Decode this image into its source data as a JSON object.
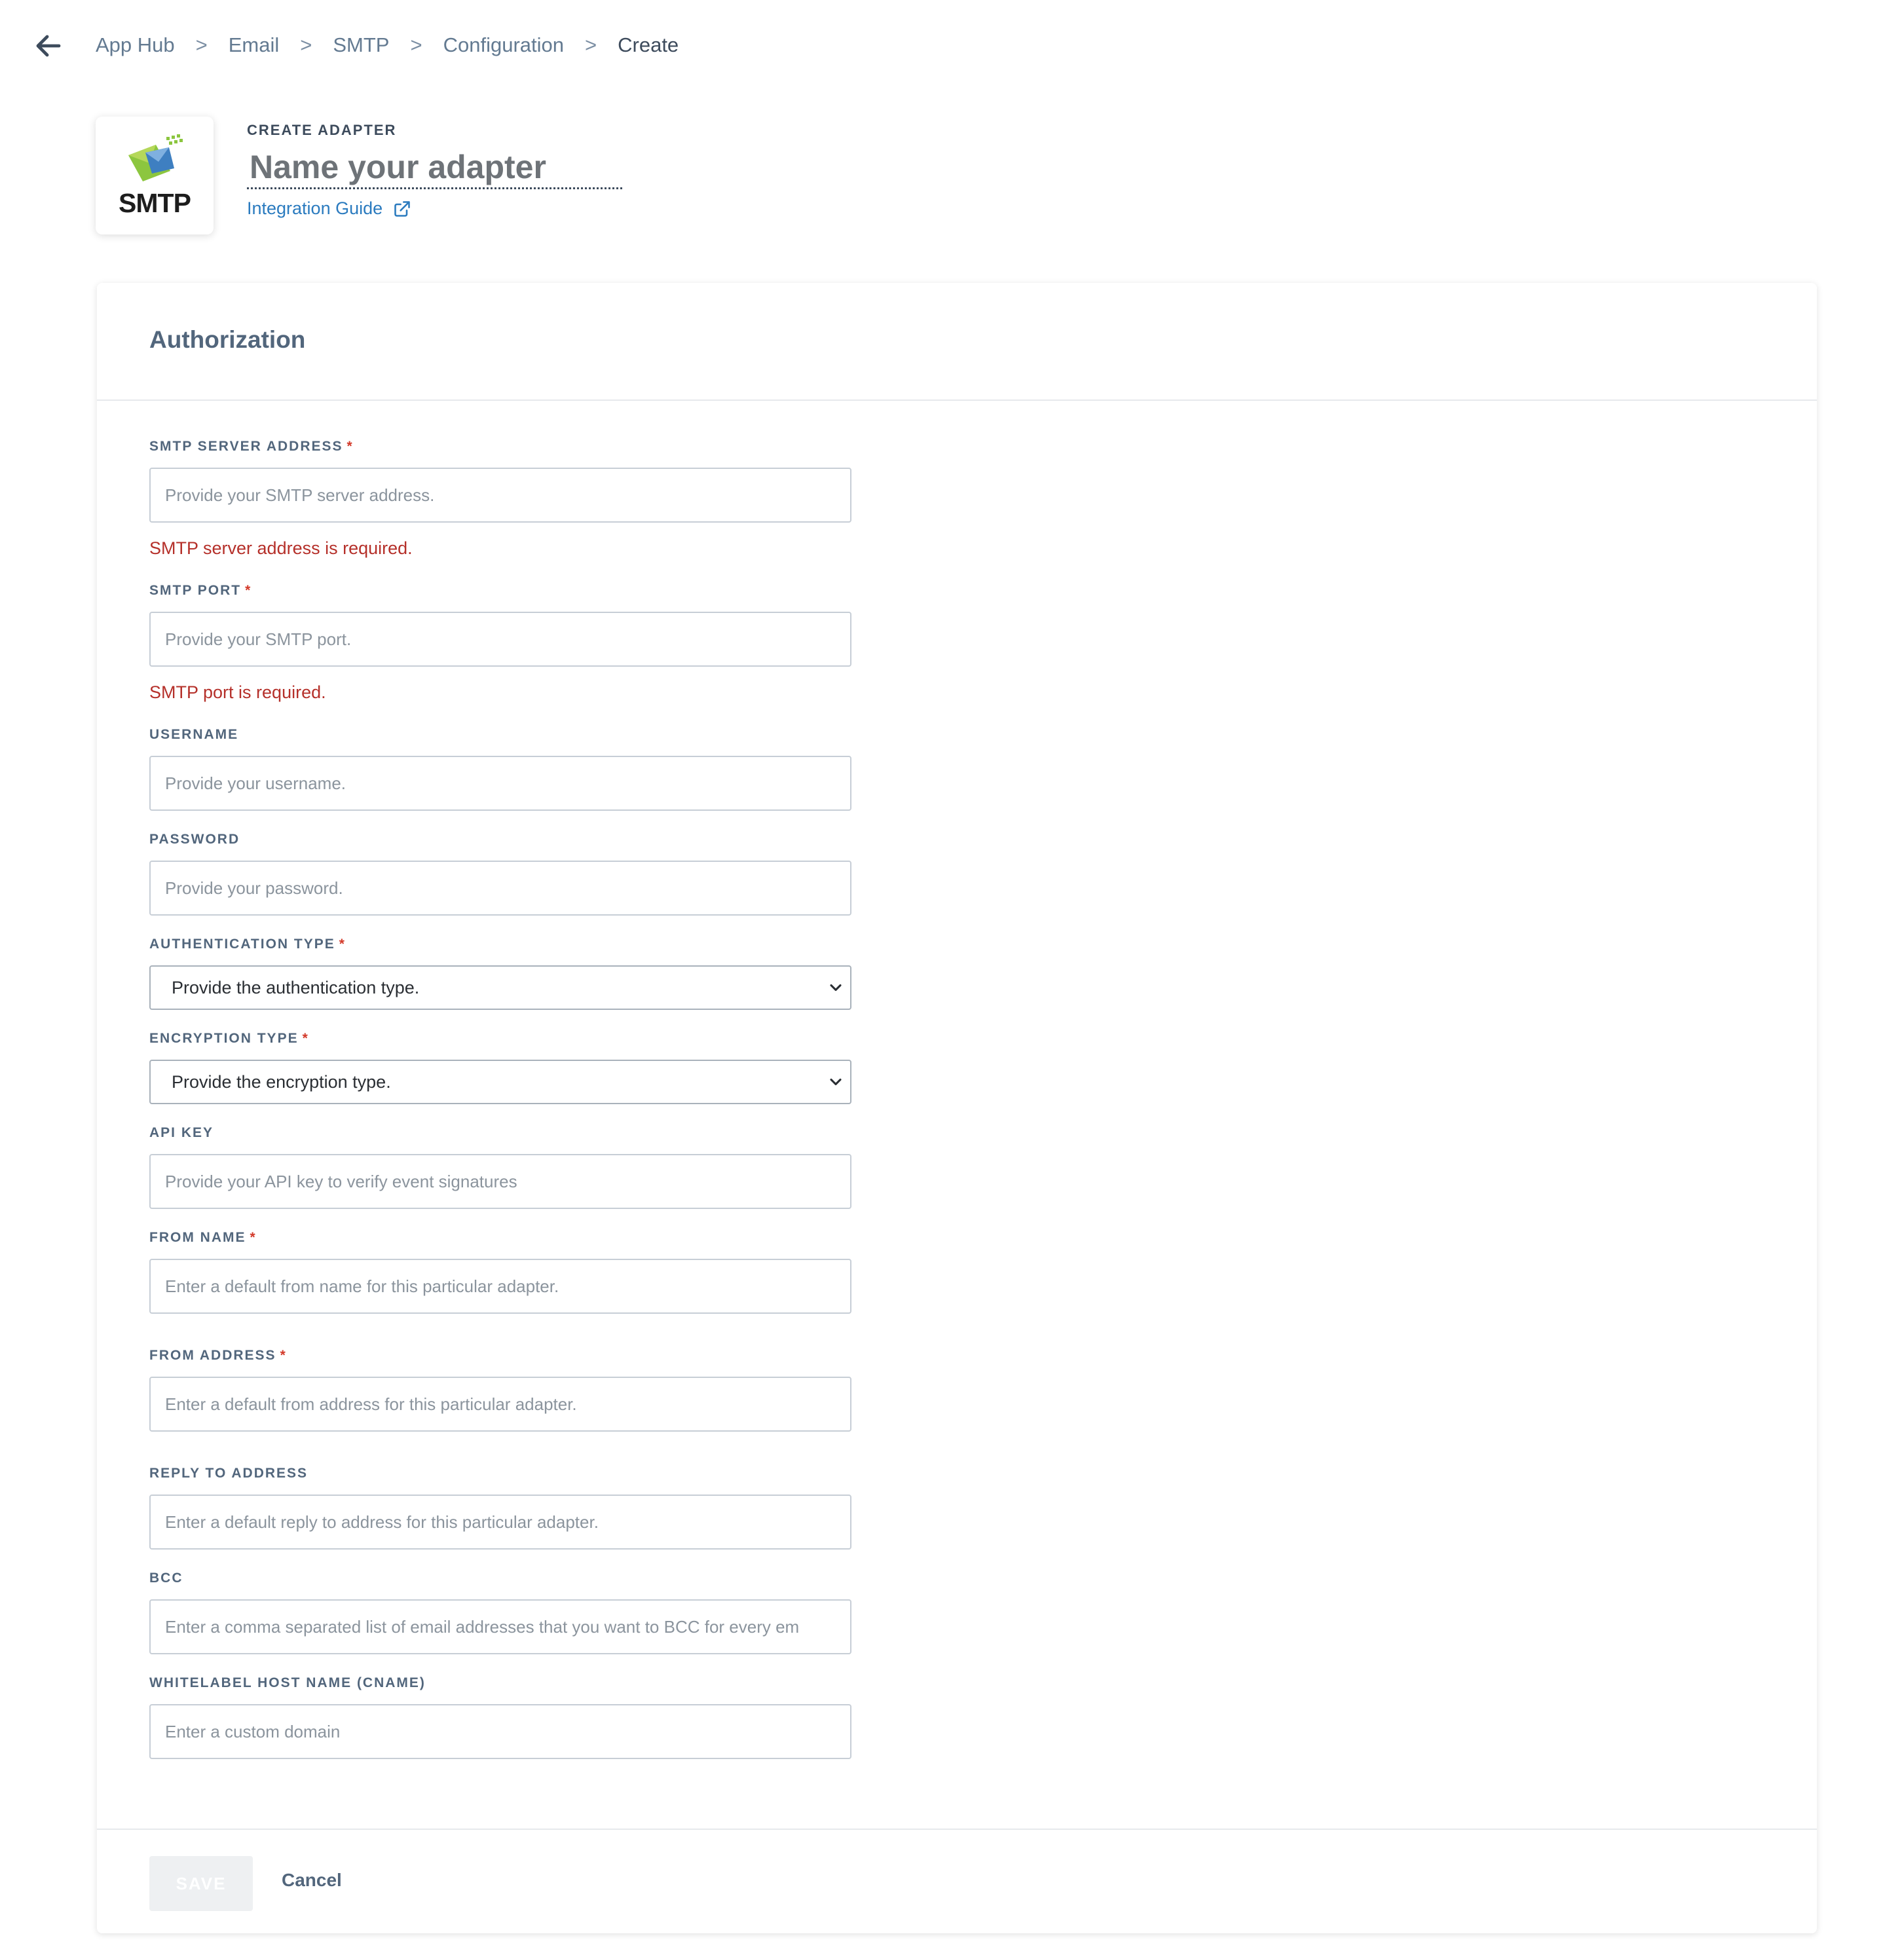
{
  "breadcrumb": {
    "items": [
      "App Hub",
      "Email",
      "SMTP",
      "Configuration"
    ],
    "current": "Create",
    "separator": ">"
  },
  "header": {
    "logo_text": "SMTP",
    "eyebrow": "CREATE ADAPTER",
    "name_placeholder": "Name your adapter",
    "guide_label": "Integration Guide"
  },
  "section": {
    "title": "Authorization"
  },
  "form": {
    "smtp_server": {
      "label": "SMTP SERVER ADDRESS",
      "required": "*",
      "placeholder": "Provide your SMTP server address.",
      "error": "SMTP server address is required."
    },
    "smtp_port": {
      "label": "SMTP PORT",
      "required": "*",
      "placeholder": "Provide your SMTP port.",
      "error": "SMTP port is required."
    },
    "username": {
      "label": "USERNAME",
      "placeholder": "Provide your username."
    },
    "password": {
      "label": "PASSWORD",
      "placeholder": "Provide your password."
    },
    "auth_type": {
      "label": "AUTHENTICATION TYPE",
      "required": "*",
      "value": "Provide the authentication type."
    },
    "encryption_type": {
      "label": "ENCRYPTION TYPE",
      "required": "*",
      "value": "Provide the encryption type."
    },
    "api_key": {
      "label": "API KEY",
      "placeholder": "Provide your API key to verify event signatures"
    },
    "from_name": {
      "label": "FROM NAME",
      "required": "*",
      "placeholder": "Enter a default from name for this particular adapter."
    },
    "from_address": {
      "label": "FROM ADDRESS",
      "required": "*",
      "placeholder": "Enter a default from address for this particular adapter."
    },
    "reply_to": {
      "label": "REPLY TO ADDRESS",
      "placeholder": "Enter a default reply to address for this particular adapter."
    },
    "bcc": {
      "label": "BCC",
      "placeholder": "Enter a comma separated list of email addresses that you want to BCC for every em"
    },
    "cname": {
      "label": "WHITELABEL HOST NAME (CNAME)",
      "placeholder": "Enter a custom domain"
    }
  },
  "footer": {
    "save_label": "SAVE",
    "cancel_label": "Cancel"
  },
  "colors": {
    "accent_link": "#2b7bbf",
    "error": "#b5302a",
    "required": "#d33a2a",
    "label": "#52667c"
  }
}
